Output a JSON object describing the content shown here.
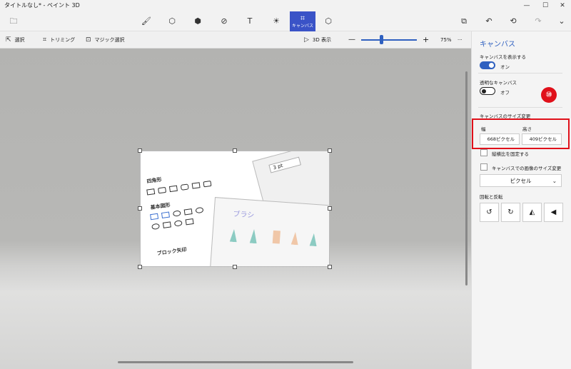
{
  "window": {
    "title": "タイトルなし* - ペイント 3D",
    "minimize": "—",
    "maximize": "☐",
    "close": "✕"
  },
  "ribbon": {
    "menu_icon": "🗀",
    "tools": [
      "🖌",
      "⬡",
      "⬢",
      "⊘",
      "T",
      "☀"
    ],
    "active_label": "キャンバス",
    "active_icon": "⌗",
    "mixed_reality_icon": "⬡",
    "right_icons": [
      "⧉",
      "↶",
      "⟲",
      "↷",
      "⌄"
    ]
  },
  "toolbar": {
    "select": "選択",
    "trim": "トリミング",
    "magic_select": "マジック選択",
    "view3d": "3D 表示",
    "zoom_minus": "—",
    "zoom_plus": "+",
    "zoom_value": "75%",
    "more": "···"
  },
  "canvas_image": {
    "stroke_size": "3 pt",
    "heading_rect": "四角形",
    "heading_basic": "基本図形",
    "heading_arrow": "ブロック矢印",
    "brush_title": "ブラシ"
  },
  "panel": {
    "title": "キャンバス",
    "show_canvas_label": "キャンバスを表示する",
    "show_canvas_state": "オン",
    "transparent_label": "透明なキャンバス",
    "transparent_state": "オフ",
    "resize_label": "キャンバスのサイズ変更",
    "width_label": "幅",
    "height_label": "高さ",
    "width_value": "668ピクセル",
    "height_value": "409ピクセル",
    "lock_ratio": "縦横比を固定する",
    "resize_image": "キャンバスでの画像のサイズ変更",
    "unit_dropdown": "ピクセル",
    "rotate_label": "回転と反転",
    "rotate_icons": [
      "↺",
      "↻",
      "◭",
      "◀"
    ]
  },
  "annotation": {
    "badge": "⑩",
    "highlight_color": "#e0101a"
  },
  "colors": {
    "accent": "#3a53c7",
    "toggle_on": "#2f60c0"
  }
}
